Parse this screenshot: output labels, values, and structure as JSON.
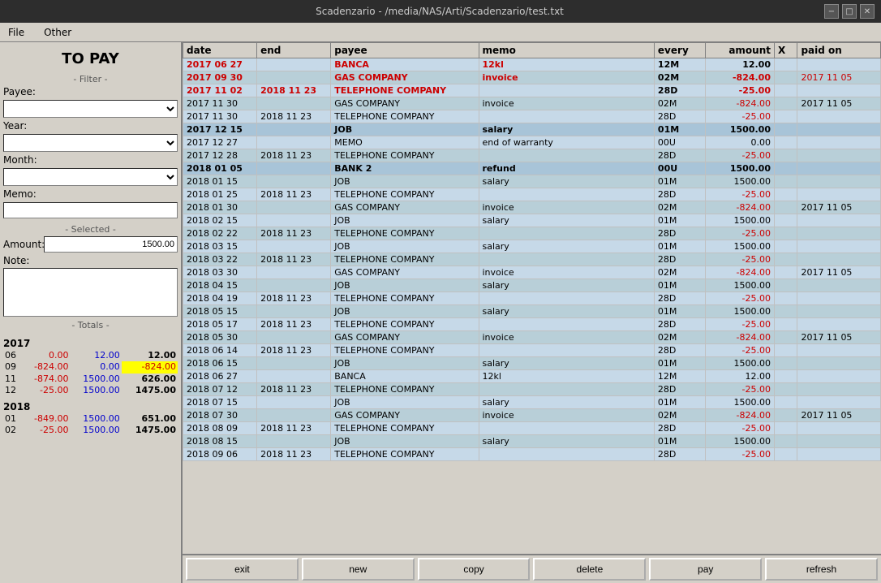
{
  "window": {
    "title": "Scadenzario - /media/NAS/Arti/Scadenzario/test.txt",
    "controls": [
      "−",
      "□",
      "✕"
    ]
  },
  "menu": {
    "items": [
      "File",
      "Other"
    ]
  },
  "left_panel": {
    "title": "TO PAY",
    "filter_label": "- Filter -",
    "payee_label": "Payee:",
    "year_label": "Year:",
    "month_label": "Month:",
    "memo_label": "Memo:",
    "selected_label": "- Selected -",
    "amount_label": "Amount:",
    "amount_value": "1500.00",
    "note_label": "Note:",
    "totals_label": "- Totals -",
    "totals": {
      "year2017": "2017",
      "rows2017": [
        {
          "month": "06",
          "col1": "0.00",
          "col2": "12.00",
          "col3": "12.00",
          "c1": "red",
          "c2": "blue",
          "c3": "black"
        },
        {
          "month": "09",
          "col1": "-824.00",
          "col2": "0.00",
          "col3": "-824.00",
          "c1": "red",
          "c2": "blue",
          "c3": "yellow",
          "highlight": true
        },
        {
          "month": "11",
          "col1": "-874.00",
          "col2": "1500.00",
          "col3": "626.00",
          "c1": "red",
          "c2": "blue",
          "c3": "black"
        },
        {
          "month": "12",
          "col1": "-25.00",
          "col2": "1500.00",
          "col3": "1475.00",
          "c1": "red",
          "c2": "blue",
          "c3": "black"
        }
      ],
      "year2018": "2018",
      "rows2018": [
        {
          "month": "01",
          "col1": "-849.00",
          "col2": "1500.00",
          "col3": "651.00",
          "c1": "red",
          "c2": "blue",
          "c3": "black"
        },
        {
          "month": "02",
          "col1": "-25.00",
          "col2": "1500.00",
          "col3": "1475.00",
          "c1": "red",
          "c2": "blue",
          "c3": "black"
        }
      ]
    }
  },
  "table": {
    "headers": [
      "date",
      "end",
      "payee",
      "memo",
      "every",
      "amount",
      "X",
      "paid on"
    ],
    "rows": [
      {
        "date": "2017 06 27",
        "end": "",
        "payee": "BANCA",
        "memo": "12kl",
        "every": "12M",
        "amount": "12.00",
        "x": "",
        "paidon": "",
        "rowclass": "row-bold row-light-blue",
        "date_color": "red",
        "payee_color": "red",
        "memo_color": "red",
        "amount_color": "red"
      },
      {
        "date": "2017 09 30",
        "end": "",
        "payee": "GAS COMPANY",
        "memo": "invoice",
        "every": "02M",
        "amount": "-824.00",
        "x": "",
        "paidon": "2017 11 05",
        "rowclass": "row-bold row-light-blue",
        "date_color": "red",
        "payee_color": "red",
        "memo_color": "red",
        "amount_color": "red",
        "paidon_color": "red"
      },
      {
        "date": "2017 11 02",
        "end": "2018 11 23",
        "payee": "TELEPHONE COMPANY",
        "memo": "",
        "every": "28D",
        "amount": "-25.00",
        "x": "",
        "paidon": "",
        "rowclass": "row-bold row-light-blue",
        "date_color": "red",
        "end_color": "red",
        "payee_color": "red",
        "amount_color": "red"
      },
      {
        "date": "2017 11 30",
        "end": "",
        "payee": "GAS COMPANY",
        "memo": "invoice",
        "every": "02M",
        "amount": "-824.00",
        "x": "",
        "paidon": "2017 11 05",
        "rowclass": "row-light-blue"
      },
      {
        "date": "2017 11 30",
        "end": "2018 11 23",
        "payee": "TELEPHONE COMPANY",
        "memo": "",
        "every": "28D",
        "amount": "-25.00",
        "x": "",
        "paidon": "",
        "rowclass": "row-light-blue"
      },
      {
        "date": "2017 12 15",
        "end": "",
        "payee": "JOB",
        "memo": "salary",
        "every": "01M",
        "amount": "1500.00",
        "x": "",
        "paidon": "",
        "rowclass": "row-bold row-medium-blue",
        "date_color": "bold",
        "payee_color": "bold",
        "memo_color": "bold",
        "amount_color": "bold"
      },
      {
        "date": "2017 12 27",
        "end": "",
        "payee": "MEMO",
        "memo": "end of warranty",
        "every": "00U",
        "amount": "0.00",
        "x": "",
        "paidon": "",
        "rowclass": "row-light-blue"
      },
      {
        "date": "2017 12 28",
        "end": "2018 11 23",
        "payee": "TELEPHONE COMPANY",
        "memo": "",
        "every": "28D",
        "amount": "-25.00",
        "x": "",
        "paidon": "",
        "rowclass": "row-light-blue"
      },
      {
        "date": "2018 01 05",
        "end": "",
        "payee": "BANK 2",
        "memo": "refund",
        "every": "00U",
        "amount": "1500.00",
        "x": "",
        "paidon": "",
        "rowclass": "row-bold row-medium-blue",
        "date_color": "bold",
        "payee_color": "bold",
        "memo_color": "bold",
        "amount_color": "bold"
      },
      {
        "date": "2018 01 15",
        "end": "",
        "payee": "JOB",
        "memo": "salary",
        "every": "01M",
        "amount": "1500.00",
        "x": "",
        "paidon": "",
        "rowclass": "row-light-blue"
      },
      {
        "date": "2018 01 25",
        "end": "2018 11 23",
        "payee": "TELEPHONE COMPANY",
        "memo": "",
        "every": "28D",
        "amount": "-25.00",
        "x": "",
        "paidon": "",
        "rowclass": "row-light-blue"
      },
      {
        "date": "2018 01 30",
        "end": "",
        "payee": "GAS COMPANY",
        "memo": "invoice",
        "every": "02M",
        "amount": "-824.00",
        "x": "",
        "paidon": "2017 11 05",
        "rowclass": "row-light-blue"
      },
      {
        "date": "2018 02 15",
        "end": "",
        "payee": "JOB",
        "memo": "salary",
        "every": "01M",
        "amount": "1500.00",
        "x": "",
        "paidon": "",
        "rowclass": "row-light-blue"
      },
      {
        "date": "2018 02 22",
        "end": "2018 11 23",
        "payee": "TELEPHONE COMPANY",
        "memo": "",
        "every": "28D",
        "amount": "-25.00",
        "x": "",
        "paidon": "",
        "rowclass": "row-light-blue"
      },
      {
        "date": "2018 03 15",
        "end": "",
        "payee": "JOB",
        "memo": "salary",
        "every": "01M",
        "amount": "1500.00",
        "x": "",
        "paidon": "",
        "rowclass": "row-light-blue"
      },
      {
        "date": "2018 03 22",
        "end": "2018 11 23",
        "payee": "TELEPHONE COMPANY",
        "memo": "",
        "every": "28D",
        "amount": "-25.00",
        "x": "",
        "paidon": "",
        "rowclass": "row-light-blue"
      },
      {
        "date": "2018 03 30",
        "end": "",
        "payee": "GAS COMPANY",
        "memo": "invoice",
        "every": "02M",
        "amount": "-824.00",
        "x": "",
        "paidon": "2017 11 05",
        "rowclass": "row-light-blue"
      },
      {
        "date": "2018 04 15",
        "end": "",
        "payee": "JOB",
        "memo": "salary",
        "every": "01M",
        "amount": "1500.00",
        "x": "",
        "paidon": "",
        "rowclass": "row-light-blue"
      },
      {
        "date": "2018 04 19",
        "end": "2018 11 23",
        "payee": "TELEPHONE COMPANY",
        "memo": "",
        "every": "28D",
        "amount": "-25.00",
        "x": "",
        "paidon": "",
        "rowclass": "row-light-blue"
      },
      {
        "date": "2018 05 15",
        "end": "",
        "payee": "JOB",
        "memo": "salary",
        "every": "01M",
        "amount": "1500.00",
        "x": "",
        "paidon": "",
        "rowclass": "row-light-blue"
      },
      {
        "date": "2018 05 17",
        "end": "2018 11 23",
        "payee": "TELEPHONE COMPANY",
        "memo": "",
        "every": "28D",
        "amount": "-25.00",
        "x": "",
        "paidon": "",
        "rowclass": "row-light-blue"
      },
      {
        "date": "2018 05 30",
        "end": "",
        "payee": "GAS COMPANY",
        "memo": "invoice",
        "every": "02M",
        "amount": "-824.00",
        "x": "",
        "paidon": "2017 11 05",
        "rowclass": "row-light-blue"
      },
      {
        "date": "2018 06 14",
        "end": "2018 11 23",
        "payee": "TELEPHONE COMPANY",
        "memo": "",
        "every": "28D",
        "amount": "-25.00",
        "x": "",
        "paidon": "",
        "rowclass": "row-light-blue"
      },
      {
        "date": "2018 06 15",
        "end": "",
        "payee": "JOB",
        "memo": "salary",
        "every": "01M",
        "amount": "1500.00",
        "x": "",
        "paidon": "",
        "rowclass": "row-light-blue"
      },
      {
        "date": "2018 06 27",
        "end": "",
        "payee": "BANCA",
        "memo": "12kl",
        "every": "12M",
        "amount": "12.00",
        "x": "",
        "paidon": "",
        "rowclass": "row-light-blue"
      },
      {
        "date": "2018 07 12",
        "end": "2018 11 23",
        "payee": "TELEPHONE COMPANY",
        "memo": "",
        "every": "28D",
        "amount": "-25.00",
        "x": "",
        "paidon": "",
        "rowclass": "row-light-blue"
      },
      {
        "date": "2018 07 15",
        "end": "",
        "payee": "JOB",
        "memo": "salary",
        "every": "01M",
        "amount": "1500.00",
        "x": "",
        "paidon": "",
        "rowclass": "row-light-blue"
      },
      {
        "date": "2018 07 30",
        "end": "",
        "payee": "GAS COMPANY",
        "memo": "invoice",
        "every": "02M",
        "amount": "-824.00",
        "x": "",
        "paidon": "2017 11 05",
        "rowclass": "row-light-blue"
      },
      {
        "date": "2018 08 09",
        "end": "2018 11 23",
        "payee": "TELEPHONE COMPANY",
        "memo": "",
        "every": "28D",
        "amount": "-25.00",
        "x": "",
        "paidon": "",
        "rowclass": "row-light-blue"
      },
      {
        "date": "2018 08 15",
        "end": "",
        "payee": "JOB",
        "memo": "salary",
        "every": "01M",
        "amount": "1500.00",
        "x": "",
        "paidon": "",
        "rowclass": "row-light-blue"
      },
      {
        "date": "2018 09 06",
        "end": "2018 11 23",
        "payee": "TELEPHONE COMPANY",
        "memo": "",
        "every": "28D",
        "amount": "-25.00",
        "x": "",
        "paidon": "",
        "rowclass": "row-light-blue"
      }
    ]
  },
  "buttons": {
    "exit": "exit",
    "new": "new",
    "copy": "copy",
    "delete": "delete",
    "pay": "pay",
    "refresh": "refresh"
  }
}
